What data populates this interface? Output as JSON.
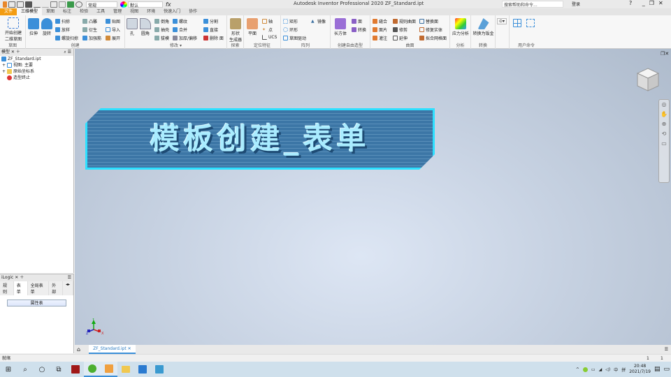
{
  "titlebar": {
    "title": "Autodesk Inventor Professional 2020   ZF_Standard.ipt",
    "appearance": "常规",
    "material": "默认",
    "search_placeholder": "搜索帮助和命令...",
    "login": "登录"
  },
  "menu": [
    "文件",
    "三维模型",
    "草图",
    "标注",
    "检验",
    "工具",
    "管理",
    "视图",
    "环境",
    "快速入门",
    "协作"
  ],
  "ribbon": {
    "sketch": {
      "label": "草图",
      "start": "开始创建\n二维草图"
    },
    "create": {
      "label": "创建",
      "items": [
        "拉伸",
        "旋转",
        "扫掠",
        "放样",
        "螺旋扫掠",
        "凸雕",
        "衍生",
        "加强筋",
        "贴图",
        "导入",
        "展开"
      ]
    },
    "modify": {
      "label": "修改 ▾",
      "items": [
        "孔",
        "圆角",
        "倒角",
        "抽壳",
        "拔模",
        "螺纹",
        "合并",
        "加厚/偏移",
        "分割",
        "直接",
        "删除 面"
      ]
    },
    "explore": {
      "label": "探索",
      "items": [
        "形状\n生成器"
      ]
    },
    "work": {
      "label": "定位特征",
      "items": [
        "平面",
        "轴",
        "点",
        "UCS"
      ]
    },
    "pattern": {
      "label": "阵列",
      "items": [
        "矩形",
        "环形",
        "草图驱动",
        "镜像"
      ]
    },
    "freeform": {
      "label": "创建自由造型",
      "items": [
        "长方体",
        "面",
        "转换"
      ]
    },
    "surface": {
      "label": "曲面",
      "items": [
        "缝合",
        "面片",
        "灌注",
        "规则曲面",
        "修剪",
        "延伸",
        "替换面",
        "修复实体",
        "拟合网格面"
      ]
    },
    "analysis": {
      "label": "分析",
      "items": [
        "应力分析"
      ]
    },
    "convert": {
      "label": "转换",
      "items": [
        "转换为钣金"
      ]
    },
    "user": {
      "label": "用户命令"
    }
  },
  "browser": {
    "tab": "模型",
    "tree": [
      "ZF_Standard.ipt",
      "视图: 主要",
      "原始坐标系",
      "造型终止"
    ]
  },
  "ilogic": {
    "title": "iLogic",
    "tabs": [
      "规则",
      "表单",
      "全局表单",
      "外部"
    ],
    "active_tab": "表单",
    "button": "属性表"
  },
  "viewport": {
    "banner": "模板创建_表单",
    "axes": [
      "X",
      "Y",
      "Z"
    ]
  },
  "doc_tab": "ZF_Standard.ipt",
  "status": {
    "text": "就绪",
    "counts": [
      "1",
      "1"
    ]
  },
  "tray": {
    "ime": "中",
    "time": "20:48",
    "date": "2021/7/19"
  },
  "colors": {
    "accent": "#f39c12",
    "banner_border": "#2de0ff",
    "banner_text": "#a9ecff"
  }
}
